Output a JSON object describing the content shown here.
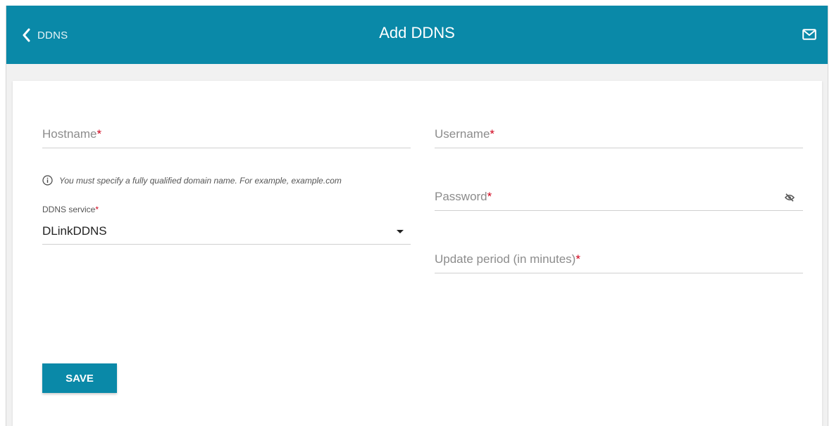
{
  "header": {
    "back_label": "DDNS",
    "title": "Add DDNS"
  },
  "form": {
    "hostname": {
      "label": "Hostname",
      "required": "*",
      "value": ""
    },
    "hostname_hint": "You must specify a fully qualified domain name. For example, example.com",
    "ddns_service": {
      "label": "DDNS service",
      "required": "*",
      "selected": "DLinkDDNS"
    },
    "username": {
      "label": "Username",
      "required": "*",
      "value": ""
    },
    "password": {
      "label": "Password",
      "required": "*",
      "value": ""
    },
    "update_period": {
      "label": "Update period (in minutes)",
      "required": "*",
      "value": ""
    },
    "save_label": "SAVE"
  },
  "icons": {
    "back": "chevron-left-icon",
    "mail": "mail-icon",
    "info": "info-icon",
    "password_visibility": "eye-off-icon",
    "dropdown": "caret-down-icon"
  },
  "colors": {
    "accent": "#0a89a8",
    "required": "#d0021b"
  }
}
